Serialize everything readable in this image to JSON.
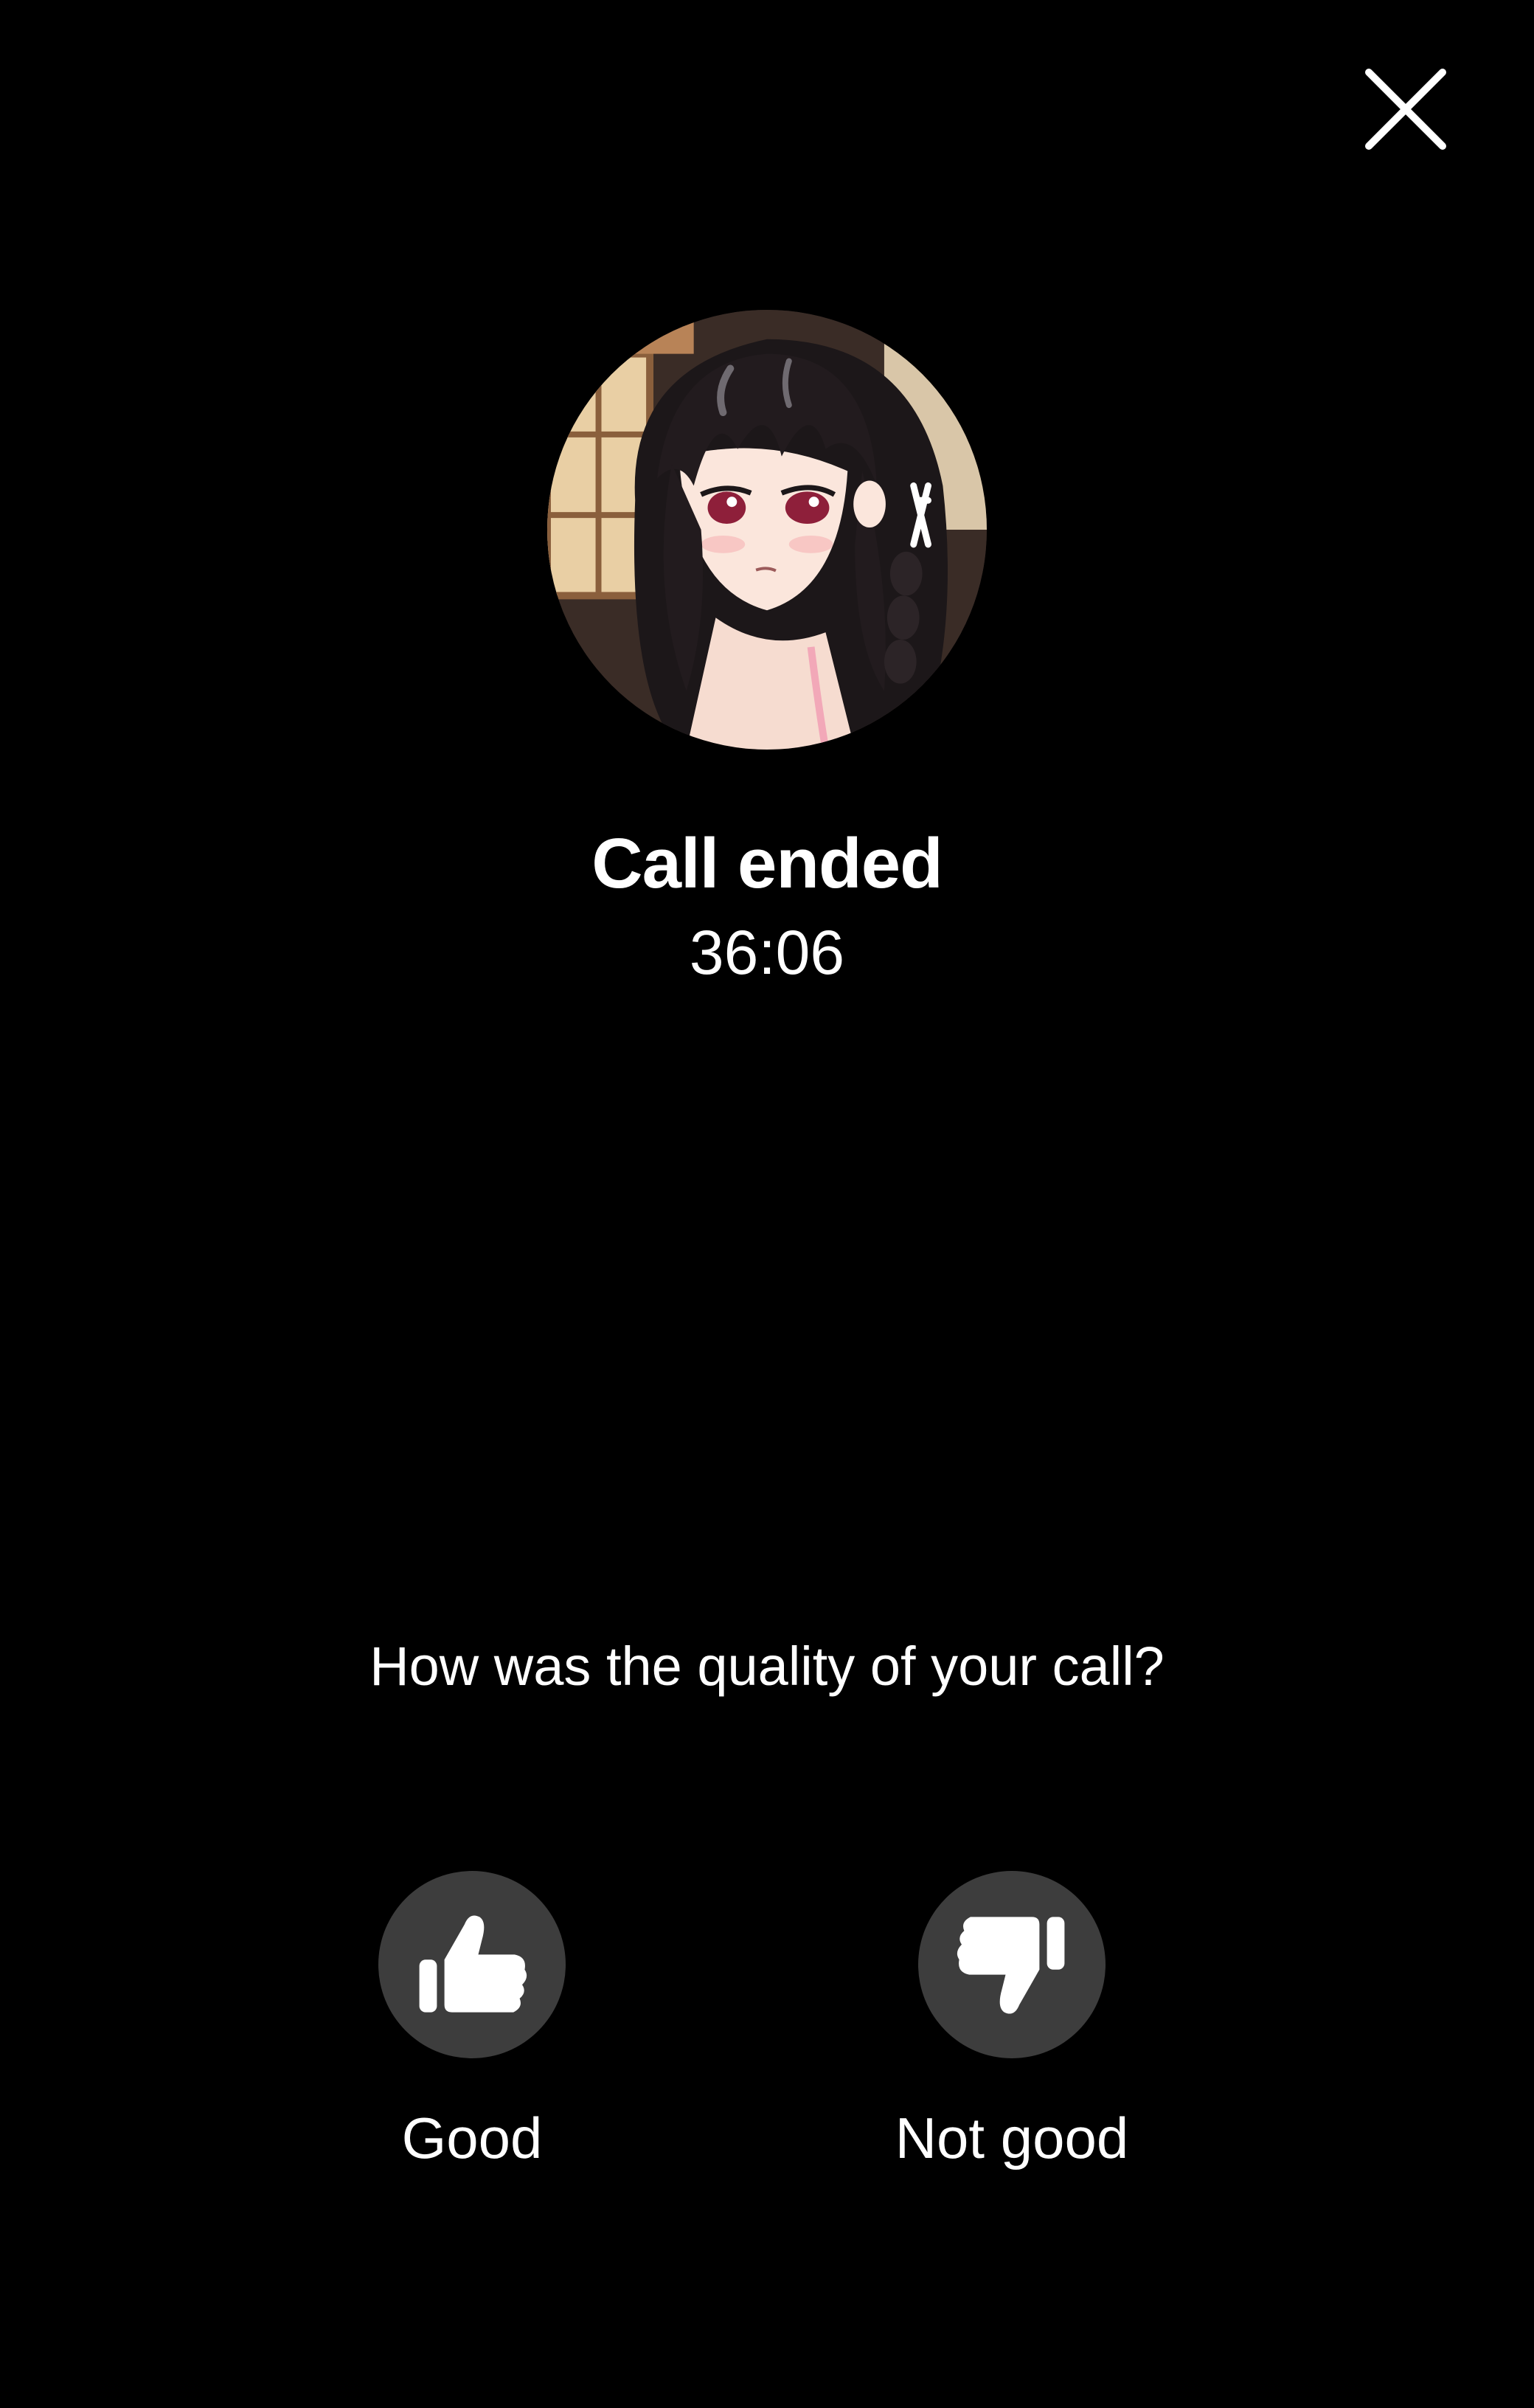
{
  "header": {
    "close_icon": "close-icon"
  },
  "call": {
    "status": "Call ended",
    "duration": "36:06",
    "avatar_icon": "contact-avatar"
  },
  "feedback": {
    "question": "How was the quality of your call?",
    "options": [
      {
        "label": "Good",
        "icon": "thumbs-up-icon"
      },
      {
        "label": "Not good",
        "icon": "thumbs-down-icon"
      }
    ]
  },
  "colors": {
    "background": "#000000",
    "text": "#ffffff",
    "button_circle": "#3d3d3d"
  }
}
